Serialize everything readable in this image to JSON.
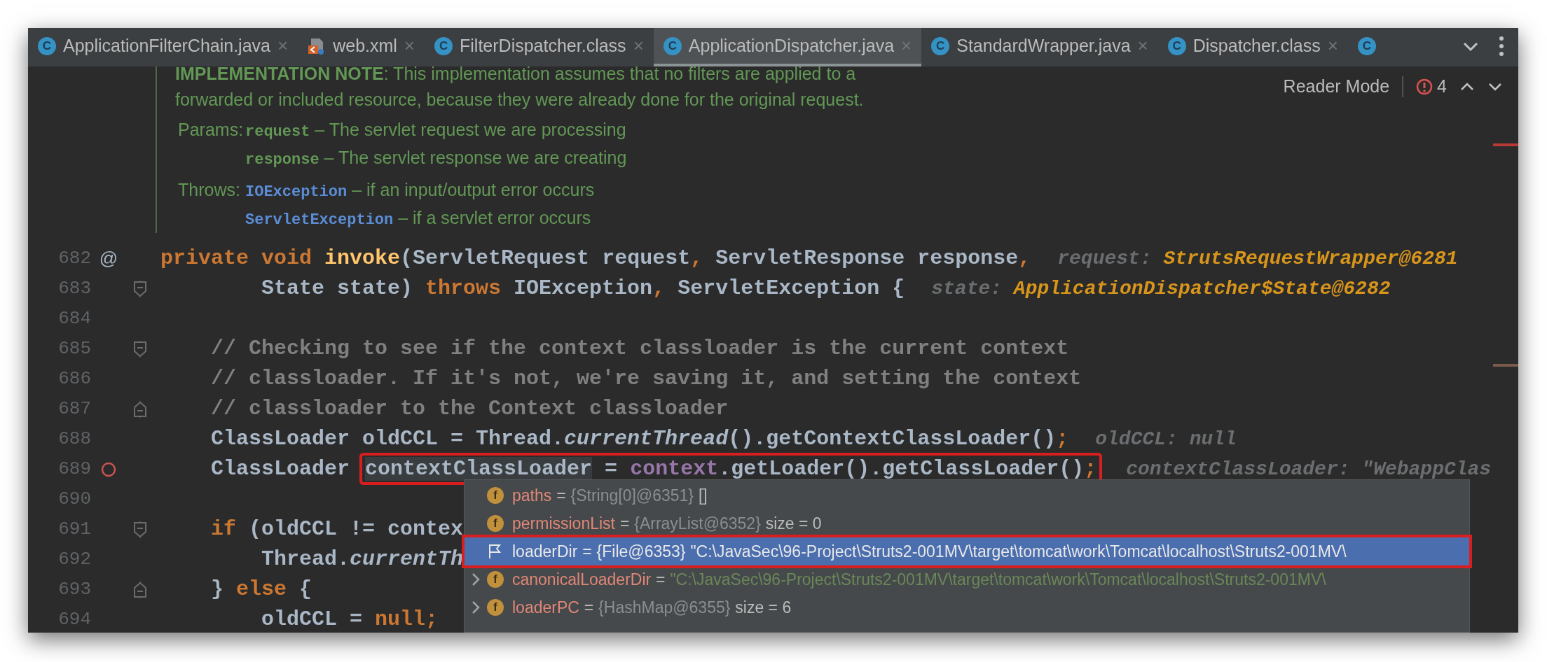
{
  "tabs": [
    {
      "kind": "class",
      "icon": "C",
      "label": "ApplicationFilterChain.java",
      "close": "×",
      "selected": false
    },
    {
      "kind": "xml",
      "label": "web.xml",
      "close": "×",
      "selected": false
    },
    {
      "kind": "class",
      "icon": "C",
      "label": "FilterDispatcher.class",
      "close": "×",
      "selected": false
    },
    {
      "kind": "class",
      "icon": "C",
      "label": "ApplicationDispatcher.java",
      "close": "×",
      "selected": true
    },
    {
      "kind": "class",
      "icon": "C",
      "label": "StandardWrapper.java",
      "close": "×",
      "selected": false
    },
    {
      "kind": "class",
      "icon": "C",
      "label": "Dispatcher.class",
      "close": "×",
      "selected": false
    },
    {
      "kind": "class",
      "icon": "C",
      "selected": false
    }
  ],
  "editor_toolbar": {
    "reader_mode": "Reader Mode",
    "problems": "4"
  },
  "doc": {
    "note_lines": [
      "**IMPLEMENTATION NOTE**: This implementation assumes that no filters are applied to a",
      "forwarded or included resource, because they were already done for the original request."
    ],
    "sections": [
      {
        "label": "Params:",
        "entries": [
          {
            "kind": "param",
            "name": "request",
            "text": " – The servlet request we are processing"
          },
          {
            "kind": "param",
            "name": "response",
            "text": " – The servlet response we are creating"
          }
        ]
      },
      {
        "label": "Throws:",
        "entries": [
          {
            "kind": "exception",
            "name": "IOException",
            "text": " – if an input/output error occurs"
          },
          {
            "kind": "exception",
            "name": "ServletException",
            "text": " – if a servlet error occurs"
          }
        ]
      }
    ]
  },
  "code_lines": [
    {
      "number": "682",
      "gutter": "@",
      "tokens": [
        {
          "kind": "kw",
          "text": "private void "
        },
        {
          "kind": "fn",
          "text": "invoke"
        },
        {
          "kind": "txt",
          "text": "(ServletRequest request"
        },
        {
          "kind": "kw",
          "text": ", "
        },
        {
          "kind": "txt",
          "text": "ServletResponse response"
        },
        {
          "kind": "kw",
          "text": ","
        }
      ],
      "hint": {
        "label": "request:",
        "value": "StrutsRequestWrapper@6281",
        "highlighted": true
      }
    },
    {
      "number": "683",
      "fold_open": true,
      "tokens": [
        {
          "kind": "txt",
          "text": "        State state) "
        },
        {
          "kind": "kw",
          "text": "throws "
        },
        {
          "kind": "txt",
          "text": "IOException"
        },
        {
          "kind": "kw",
          "text": ", "
        },
        {
          "kind": "txt",
          "text": "ServletException {"
        }
      ],
      "hint": {
        "label": "state:",
        "value": "ApplicationDispatcher$State@6282",
        "highlighted": true
      }
    },
    {
      "number": "684"
    },
    {
      "number": "685",
      "fold_open": true,
      "tokens": [
        {
          "kind": "cmt",
          "text": "    // Checking to see if the context classloader is the current context"
        }
      ]
    },
    {
      "number": "686",
      "tokens": [
        {
          "kind": "cmt",
          "text": "    // classloader. If it's not, we're saving it, and setting the context"
        }
      ]
    },
    {
      "number": "687",
      "fold_close": true,
      "tokens": [
        {
          "kind": "cmt",
          "text": "    // classloader to the Context classloader"
        }
      ]
    },
    {
      "number": "688",
      "tokens": [
        {
          "kind": "txt",
          "text": "    ClassLoader oldCCL = Thread."
        },
        {
          "kind": "it",
          "text": "currentThread"
        },
        {
          "kind": "txt",
          "text": "().getContextClassLoader()"
        },
        {
          "kind": "kw",
          "text": ";"
        }
      ],
      "hint": {
        "label": "oldCCL:",
        "value": "null",
        "highlighted": false
      }
    },
    {
      "number": "689",
      "breakpoint": true,
      "tokens": [
        {
          "kind": "txt",
          "text": "    ClassLoader "
        },
        {
          "kind": "sel",
          "text": "contextClassLoader",
          "framed": true
        },
        {
          "kind": "txt",
          "text": " = ",
          "framed": true
        },
        {
          "kind": "field",
          "text": "context",
          "framed": true
        },
        {
          "kind": "txt",
          "text": ".getLoader().getClassLoader()",
          "framed": true
        },
        {
          "kind": "kw",
          "text": ";",
          "framed": true
        }
      ],
      "hint": {
        "label": "contextClassLoader:",
        "value": "\"WebappClas",
        "highlighted": false
      }
    },
    {
      "number": "690"
    },
    {
      "number": "691",
      "fold_open": true,
      "tokens": [
        {
          "kind": "kw",
          "text": "    if"
        },
        {
          "kind": "txt",
          "text": " (oldCCL != contex"
        }
      ]
    },
    {
      "number": "692",
      "tokens": [
        {
          "kind": "txt",
          "text": "        Thread."
        },
        {
          "kind": "it",
          "text": "currentTh"
        }
      ]
    },
    {
      "number": "693",
      "fold_close": true,
      "tokens": [
        {
          "kind": "txt",
          "text": "    } "
        },
        {
          "kind": "kw",
          "text": "else"
        },
        {
          "kind": "txt",
          "text": " {"
        }
      ]
    },
    {
      "number": "694",
      "tokens": [
        {
          "kind": "txt",
          "text": "        oldCCL = "
        },
        {
          "kind": "kw",
          "text": "null;"
        }
      ]
    }
  ],
  "variables_popup": [
    {
      "kind": "field",
      "icon": "f",
      "name": "paths",
      "operator": "=",
      "type": "{String[0]@6351}",
      "value": "[]",
      "string_value": false,
      "selected": false,
      "expandable": false
    },
    {
      "kind": "field",
      "icon": "f",
      "name": "permissionList",
      "operator": "=",
      "type": "{ArrayList@6352}",
      "value": "size = 0",
      "string_value": false,
      "selected": false,
      "expandable": false
    },
    {
      "kind": "flag",
      "name": "loaderDir",
      "operator": "=",
      "type": "{File@6353}",
      "value": "\"C:\\JavaSec\\96-Project\\Struts2-001MV\\target\\tomcat\\work\\Tomcat\\localhost\\Struts2-001MV\\",
      "string_value": true,
      "selected": true,
      "annotated": true,
      "expandable": false
    },
    {
      "kind": "field",
      "icon": "f",
      "name": "canonicalLoaderDir",
      "operator": "=",
      "value": "\"C:\\JavaSec\\96-Project\\Struts2-001MV\\target\\tomcat\\work\\Tomcat\\localhost\\Struts2-001MV\\",
      "string_value": true,
      "selected": false,
      "expandable": true
    },
    {
      "kind": "field",
      "icon": "f",
      "name": "loaderPC",
      "operator": "=",
      "type": "{HashMap@6355}",
      "value": "size = 6",
      "string_value": false,
      "selected": false,
      "expandable": true
    }
  ]
}
